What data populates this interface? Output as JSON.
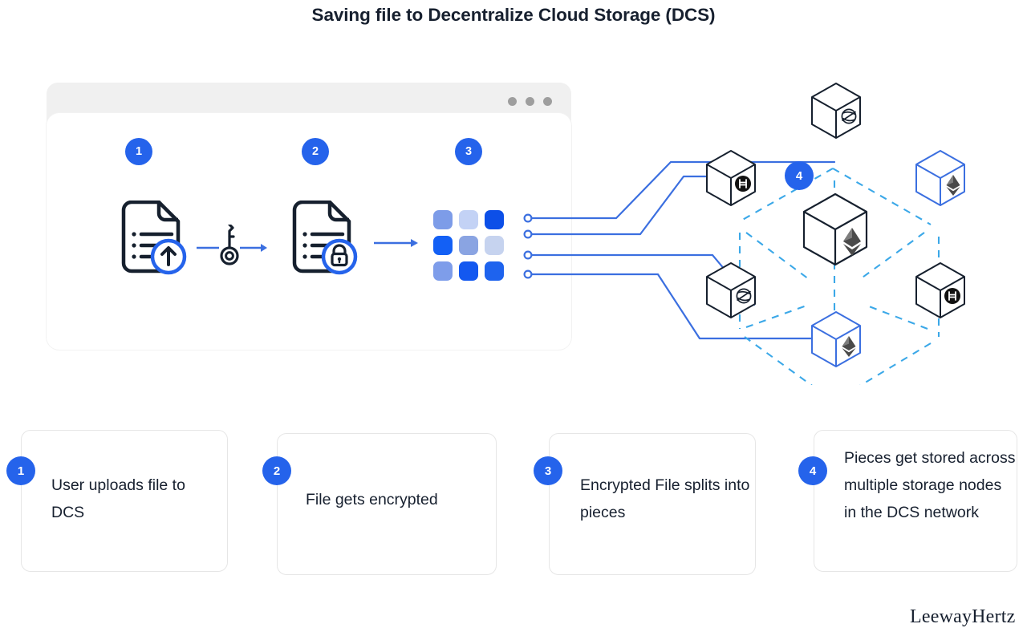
{
  "page": {
    "title": "Saving file to Decentralize Cloud Storage (DCS)",
    "brand": "LeewayHertz"
  },
  "colors": {
    "accent_blue": "#2563EB",
    "line_blue": "#3B6FE0",
    "dashed_blue": "#3BA8E8",
    "dark_ink": "#17202F",
    "window_chrome": "#F0F0F0",
    "card_border": "#E6E6E6"
  },
  "window": {
    "dots": [
      "dot-1",
      "dot-2",
      "dot-3"
    ],
    "steps": [
      {
        "number": "1",
        "icon": "file-upload-icon",
        "label": "upload"
      },
      {
        "number": "2",
        "icon": "file-lock-icon",
        "label": "encrypt"
      },
      {
        "number": "3",
        "icon": "pixel-grid-icon",
        "label": "split"
      }
    ],
    "transition_icons": [
      "key-icon",
      "arrow-right-icon"
    ]
  },
  "pixel_grid": {
    "rows": 3,
    "cols": 3,
    "cells": [
      {
        "shade": "#7D9CE8"
      },
      {
        "shade": "#C3D2F5"
      },
      {
        "shade": "#0C4FE8"
      },
      {
        "shade": "#1360F5"
      },
      {
        "shade": "#8AA4E2"
      },
      {
        "shade": "#C6D3EF"
      },
      {
        "shade": "#7E9DEA"
      },
      {
        "shade": "#1358F0"
      },
      {
        "shade": "#1E63EE"
      }
    ]
  },
  "network": {
    "badge": "4",
    "nodes": [
      {
        "id": "node-top",
        "logo": "stellar-icon",
        "outline": "dark",
        "size": "small"
      },
      {
        "id": "node-left-upper",
        "logo": "hedera-icon",
        "outline": "dark",
        "size": "small"
      },
      {
        "id": "node-right-upper",
        "logo": "ethereum-icon",
        "outline": "blue",
        "size": "small"
      },
      {
        "id": "node-center",
        "logo": "ethereum-icon",
        "outline": "dark",
        "size": "large"
      },
      {
        "id": "node-left-lower",
        "logo": "stellar-icon",
        "outline": "dark",
        "size": "small"
      },
      {
        "id": "node-right-lower",
        "logo": "hedera-icon",
        "outline": "dark",
        "size": "small"
      },
      {
        "id": "node-bottom",
        "logo": "ethereum-icon",
        "outline": "blue",
        "size": "small"
      }
    ],
    "connector_ports": 4
  },
  "cards": [
    {
      "number": "1",
      "text": "User uploads file to DCS"
    },
    {
      "number": "2",
      "text": "File gets encrypted"
    },
    {
      "number": "3",
      "text": "Encrypted File splits into pieces"
    },
    {
      "number": "4",
      "text": "Pieces get stored across multiple storage nodes in the DCS network"
    }
  ],
  "chart_data": {
    "type": "diagram",
    "title": "Saving file to Decentralize Cloud Storage (DCS)",
    "flow": [
      "User uploads file to DCS",
      "File gets encrypted",
      "Encrypted File splits into pieces",
      "Pieces get stored across multiple storage nodes in the DCS network"
    ]
  }
}
